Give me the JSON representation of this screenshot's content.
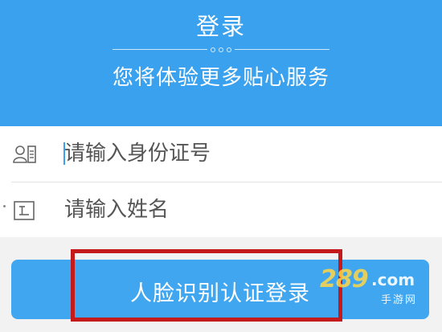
{
  "header": {
    "title": "登录",
    "subtitle": "您将体验更多贴心服务"
  },
  "form": {
    "id_field": {
      "icon": "id-card-icon",
      "placeholder": "请输入身份证号"
    },
    "name_field": {
      "icon": "name-field-icon",
      "placeholder": "请输入姓名"
    }
  },
  "login_button": {
    "label": "人脸识别认证登录"
  },
  "watermark": {
    "main": "289",
    "domain": ".com",
    "sub": "手游网"
  },
  "colors": {
    "header_blue": "#3aa1ee",
    "button_blue": "#40a6f0",
    "highlight_red": "#c51a1c"
  }
}
